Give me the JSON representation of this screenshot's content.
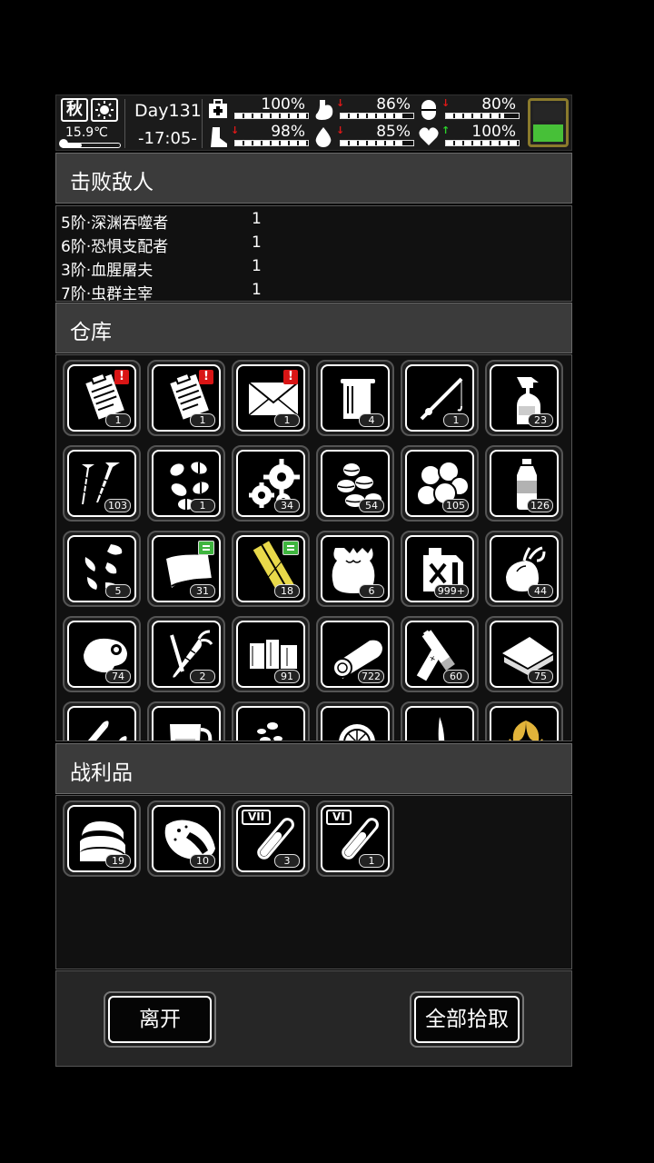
{
  "status": {
    "season": "秋",
    "weather_icon": "sun-icon",
    "temperature": "15.9℃",
    "temperature_fraction": 0.35,
    "day": "Day131",
    "time": "-17:05-",
    "stats": [
      {
        "id": "health",
        "icon": "medkit-icon",
        "value": "100%",
        "fraction": 1.0,
        "trend": ""
      },
      {
        "id": "hunger",
        "icon": "stomach-icon",
        "value": "86%",
        "fraction": 0.86,
        "trend": "down"
      },
      {
        "id": "medicine",
        "icon": "pill-icon",
        "value": "80%",
        "fraction": 0.8,
        "trend": "down"
      },
      {
        "id": "stamina",
        "icon": "boot-icon",
        "value": "98%",
        "fraction": 0.98,
        "trend": "down"
      },
      {
        "id": "thirst",
        "icon": "water-drop-icon",
        "value": "85%",
        "fraction": 0.85,
        "trend": "down"
      },
      {
        "id": "mood",
        "icon": "heart-icon",
        "value": "100%",
        "fraction": 1.0,
        "trend": "up"
      }
    ],
    "battery_level": 0.5,
    "colors": {
      "battery_border": "#8a7a2c",
      "battery_fill": "#47c038",
      "trend_down": "#e01818",
      "trend_up": "#2bd42b"
    }
  },
  "defeated": {
    "title": "击败敌人",
    "rows": [
      {
        "name": "5阶·深渊吞噬者",
        "count": "1"
      },
      {
        "name": "6阶·恐惧支配者",
        "count": "1"
      },
      {
        "name": "3阶·血腥屠夫",
        "count": "1"
      },
      {
        "name": "7阶·虫群主宰",
        "count": "1"
      }
    ]
  },
  "storage": {
    "title": "仓库",
    "items": [
      {
        "icon": "clipboard-icon",
        "count": "1",
        "badge": "alert"
      },
      {
        "icon": "clipboard-icon",
        "count": "1",
        "badge": "alert"
      },
      {
        "icon": "envelope-icon",
        "count": "1",
        "badge": "alert"
      },
      {
        "icon": "towel-icon",
        "count": "4",
        "badge": ""
      },
      {
        "icon": "fishing-rod-icon",
        "count": "1",
        "badge": ""
      },
      {
        "icon": "spray-bottle-icon",
        "count": "23",
        "badge": ""
      },
      {
        "icon": "screws-icon",
        "count": "103",
        "badge": ""
      },
      {
        "icon": "pills-icon",
        "count": "1",
        "badge": ""
      },
      {
        "icon": "gears-icon",
        "count": "34",
        "badge": ""
      },
      {
        "icon": "seeds-icon",
        "count": "54",
        "badge": ""
      },
      {
        "icon": "potatoes-icon",
        "count": "105",
        "badge": ""
      },
      {
        "icon": "water-bottle-icon",
        "count": "126",
        "badge": ""
      },
      {
        "icon": "sunflower-seeds-icon",
        "count": "5",
        "badge": ""
      },
      {
        "icon": "scroll-icon",
        "count": "31",
        "badge": "note"
      },
      {
        "icon": "gold-bars-icon",
        "count": "18",
        "badge": "note"
      },
      {
        "icon": "sack-icon",
        "count": "6",
        "badge": ""
      },
      {
        "icon": "fuel-can-icon",
        "count": "999+",
        "badge": ""
      },
      {
        "icon": "onion-icon",
        "count": "44",
        "badge": ""
      },
      {
        "icon": "meat-icon",
        "count": "74",
        "badge": ""
      },
      {
        "icon": "carrot-icon",
        "count": "2",
        "badge": ""
      },
      {
        "icon": "wood-icon",
        "count": "91",
        "badge": ""
      },
      {
        "icon": "log-icon",
        "count": "722",
        "badge": ""
      },
      {
        "icon": "battery-icon",
        "count": "60",
        "badge": ""
      },
      {
        "icon": "cloth-icon",
        "count": "75",
        "badge": ""
      },
      {
        "icon": "bullets-icon",
        "count": "",
        "badge": ""
      },
      {
        "icon": "measuring-cup-icon",
        "count": "",
        "badge": ""
      },
      {
        "icon": "pebbles-icon",
        "count": "",
        "badge": ""
      },
      {
        "icon": "orange-icon",
        "count": "",
        "badge": ""
      },
      {
        "icon": "feather-icon",
        "count": "",
        "badge": ""
      },
      {
        "icon": "leaves-icon",
        "count": "",
        "badge": ""
      }
    ]
  },
  "loot": {
    "title": "战利品",
    "items": [
      {
        "icon": "fabric-icon",
        "count": "19",
        "badge": ""
      },
      {
        "icon": "raw-meat-icon",
        "count": "10",
        "badge": ""
      },
      {
        "icon": "test-tube-vii-icon",
        "count": "3",
        "badge": "",
        "label": "VII"
      },
      {
        "icon": "test-tube-vi-icon",
        "count": "1",
        "badge": "",
        "label": "VI"
      }
    ]
  },
  "footer": {
    "leave_label": "离开",
    "pick_all_label": "全部拾取"
  }
}
